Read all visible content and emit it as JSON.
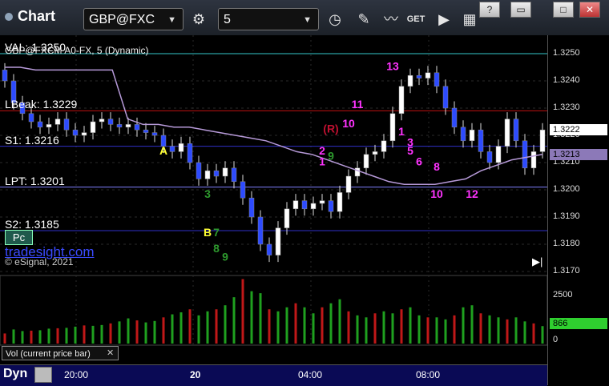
{
  "toolbar": {
    "app_title": "Chart",
    "symbol": "GBP@FXC",
    "interval": "5",
    "get_label": "GET",
    "win_help": "?",
    "win_min": "▭",
    "win_max": "□",
    "win_close": "✕"
  },
  "chart_info": {
    "instrument_line": "GBP@FXCM A0-FX, 5 (Dynamic)",
    "brand": "tradesight.com",
    "copyright": "© eSignal, 2021",
    "pc_button": "Pc",
    "vol_caption": "Vol (current price bar)",
    "dyn_label": "Dyn"
  },
  "levels": [
    {
      "label": "VAL: 1.3250",
      "value": 1.325,
      "color": "#33c7cc"
    },
    {
      "label": "LBeak: 1.3229",
      "value": 1.3229,
      "color": "#c01010"
    },
    {
      "label": "S1: 1.3216",
      "value": 1.3216,
      "color": "#3030c8"
    },
    {
      "label": "LPT: 1.3201",
      "value": 1.3201,
      "color": "#8080ff"
    },
    {
      "label": "S2: 1.3185",
      "value": 1.3185,
      "color": "#3030c8"
    }
  ],
  "price_tags": {
    "last": "1.3222",
    "ma": "1.3213",
    "volume": "866"
  },
  "chart_data": {
    "type": "candlestick",
    "ylim": [
      1.317,
      1.3255
    ],
    "y_ticks": [
      "1.3250",
      "1.3240",
      "1.3230",
      "1.3220",
      "1.3210",
      "1.3200",
      "1.3190",
      "1.3180",
      "1.3170"
    ],
    "volume_ticks": [
      "2500",
      "0"
    ],
    "time_labels": [
      "20:00",
      "20",
      "04:00",
      "08:00"
    ],
    "price_path": [
      1.324,
      1.3232,
      1.3228,
      1.3225,
      1.3223,
      1.3224,
      1.3226,
      1.3222,
      1.322,
      1.3221,
      1.3225,
      1.3226,
      1.3224,
      1.3223,
      1.3224,
      1.3222,
      1.3221,
      1.322,
      1.3216,
      1.3214,
      1.3217,
      1.321,
      1.3204,
      1.3207,
      1.3205,
      1.3208,
      1.3203,
      1.3197,
      1.319,
      1.318,
      1.3176,
      1.3186,
      1.3193,
      1.3196,
      1.3193,
      1.3195,
      1.3196,
      1.3192,
      1.3199,
      1.3205,
      1.3208,
      1.3213,
      1.3214,
      1.3218,
      1.3228,
      1.3238,
      1.3242,
      1.3241,
      1.3243,
      1.3238,
      1.323,
      1.3223,
      1.3218,
      1.3222,
      1.3214,
      1.321,
      1.3216,
      1.3226,
      1.3218,
      1.3208,
      1.3214,
      1.3222
    ],
    "ma_path": [
      1.3245,
      1.3245,
      1.3244,
      1.3244,
      1.3244,
      1.3244,
      1.3244,
      1.3244,
      1.3226,
      1.3224,
      1.3224,
      1.3223,
      1.3223,
      1.3222,
      1.3221,
      1.322,
      1.3219,
      1.3218,
      1.3216,
      1.3214,
      1.3213,
      1.3211,
      1.3209,
      1.3207,
      1.3205,
      1.3203,
      1.3202,
      1.3202,
      1.3202,
      1.3203,
      1.3204,
      1.3207,
      1.3209,
      1.3211,
      1.3212,
      1.3213
    ],
    "volume": [
      500,
      700,
      620,
      640,
      660,
      740,
      760,
      780,
      840,
      900,
      880,
      920,
      1000,
      1100,
      1250,
      1150,
      1050,
      1120,
      1300,
      1450,
      1550,
      1700,
      1400,
      1600,
      1700,
      1900,
      2300,
      3200,
      2600,
      2500,
      1700,
      1600,
      1800,
      2000,
      1800,
      1500,
      1800,
      2000,
      2200,
      1600,
      1400,
      1300,
      1500,
      1600,
      1500,
      1700,
      1800,
      1400,
      1300,
      1300,
      1200,
      1400,
      1800,
      1900,
      1500,
      1400,
      1300,
      1200,
      1300,
      1100,
      1000,
      866
    ],
    "annotations": [
      {
        "text": "A",
        "color": "#ffff33",
        "price": 1.3213,
        "idx": 18
      },
      {
        "text": "B",
        "color": "#ffff33",
        "price": 1.3183,
        "idx": 23
      },
      {
        "text": "13",
        "color": "#ff33ff",
        "price": 1.3244,
        "idx": 44
      },
      {
        "text": "11",
        "color": "#ff33ff",
        "price": 1.323,
        "idx": 40
      },
      {
        "text": "(R)",
        "color": "#c01030",
        "price": 1.3221,
        "idx": 37
      },
      {
        "text": "10",
        "color": "#ff33ff",
        "price": 1.3223,
        "idx": 39
      },
      {
        "text": "2",
        "color": "#ff33ff",
        "price": 1.3213,
        "idx": 36
      },
      {
        "text": "1",
        "color": "#ff33ff",
        "price": 1.3209,
        "idx": 36
      },
      {
        "text": "1",
        "color": "#ff33ff",
        "price": 1.322,
        "idx": 45
      },
      {
        "text": "3",
        "color": "#ff33ff",
        "price": 1.3216,
        "idx": 46
      },
      {
        "text": "5",
        "color": "#ff33ff",
        "price": 1.3213,
        "idx": 46
      },
      {
        "text": "6",
        "color": "#ff33ff",
        "price": 1.3209,
        "idx": 47
      },
      {
        "text": "8",
        "color": "#ff33ff",
        "price": 1.3207,
        "idx": 49
      },
      {
        "text": "10",
        "color": "#ff33ff",
        "price": 1.3197,
        "idx": 49
      },
      {
        "text": "12",
        "color": "#ff33ff",
        "price": 1.3197,
        "idx": 53
      },
      {
        "text": "3",
        "color": "#2e9a2e",
        "price": 1.3197,
        "idx": 23
      },
      {
        "text": "7",
        "color": "#2e9a2e",
        "price": 1.3183,
        "idx": 24
      },
      {
        "text": "8",
        "color": "#2e9a2e",
        "price": 1.3177,
        "idx": 24
      },
      {
        "text": "9",
        "color": "#2e9a2e",
        "price": 1.3174,
        "idx": 25
      },
      {
        "text": "9",
        "color": "#2e9a2e",
        "price": 1.3211,
        "idx": 37
      }
    ]
  }
}
